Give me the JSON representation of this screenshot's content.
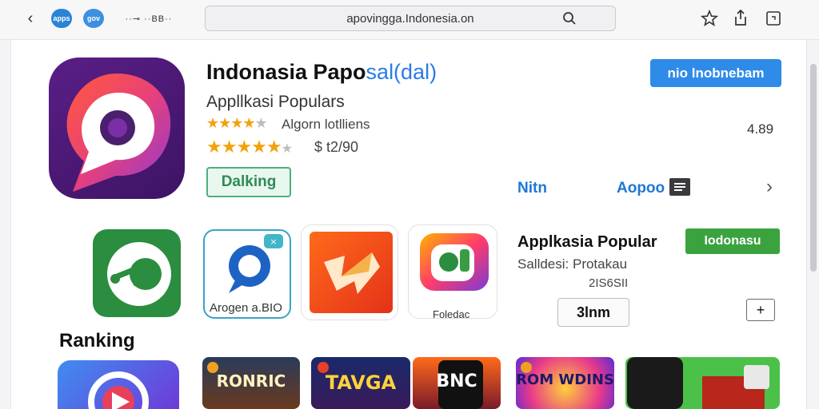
{
  "browser": {
    "url": "apovingga.Indonesia.on",
    "pill_a": "apps",
    "pill_b": "gov",
    "tabs_text": "··⊸ ··BB··"
  },
  "app": {
    "title_main": "Indonasia Papo",
    "title_sub": "sal(dal)",
    "subtitle": "Appllkasi Populars",
    "rating_text": "Algorn lotlliens",
    "price_text": "$ t2/90",
    "version": "4.89",
    "get_label": "Dalking",
    "primary_label": "nio lnobnebam",
    "link_a": "Nitn",
    "link_b": "Aopoo"
  },
  "featured": {
    "title": "Applkasia Popular",
    "subtitle": "Salldesi: Protakau",
    "count": "2IS6SII",
    "install_label": "Iodonasu",
    "open_label": "3lnm",
    "plus_label": "+"
  },
  "apps": [
    {
      "label": ""
    },
    {
      "label": "Arogen a.BIO"
    },
    {
      "label": ""
    },
    {
      "label": "Foledac"
    }
  ],
  "ranking": {
    "title": "Ranking",
    "cards": [
      {
        "text": "RONRIC"
      },
      {
        "text": "TAVGA"
      },
      {
        "text": "BNC"
      },
      {
        "text": "ROM WDINS"
      },
      {
        "text": ""
      }
    ]
  },
  "colors": {
    "accent": "#2f8be8",
    "install": "#3aa33f",
    "star": "#f2a20b"
  }
}
